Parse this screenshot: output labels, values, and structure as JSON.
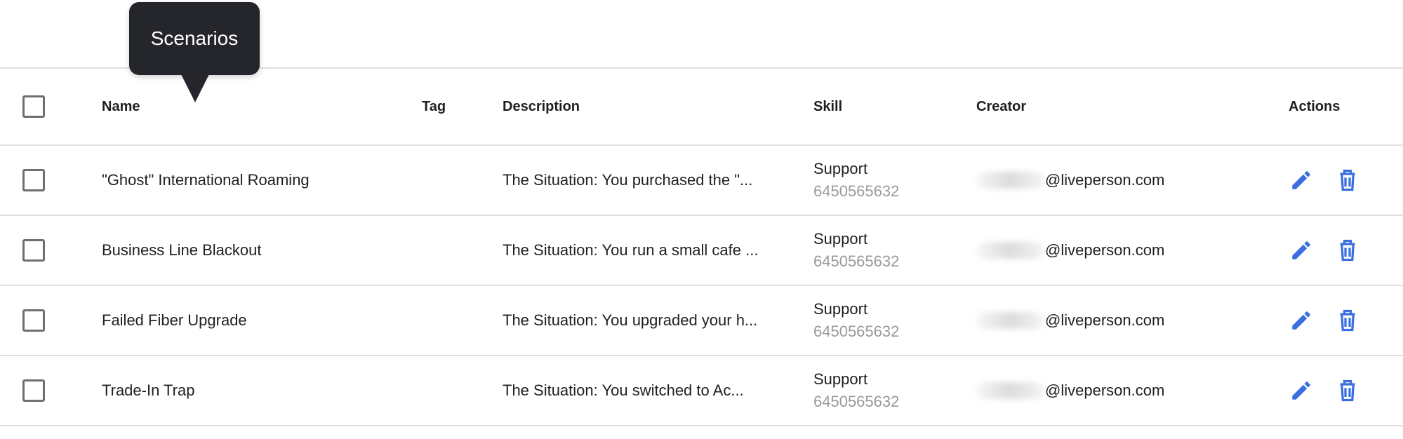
{
  "tooltip": {
    "text": "Scenarios"
  },
  "table": {
    "headers": {
      "name": "Name",
      "tag": "Tag",
      "description": "Description",
      "skill": "Skill",
      "creator": "Creator",
      "actions": "Actions"
    },
    "rows": [
      {
        "name": "\"Ghost\" International Roaming",
        "tag": "",
        "description": "The Situation: You purchased the \"...",
        "skill": "Support",
        "skill_id": "6450565632",
        "creator_domain": "@liveperson.com"
      },
      {
        "name": "Business Line Blackout",
        "tag": "",
        "description": "The Situation: You run a small cafe ...",
        "skill": "Support",
        "skill_id": "6450565632",
        "creator_domain": "@liveperson.com"
      },
      {
        "name": "Failed Fiber Upgrade",
        "tag": "",
        "description": "The Situation: You upgraded your h...",
        "skill": "Support",
        "skill_id": "6450565632",
        "creator_domain": "@liveperson.com"
      },
      {
        "name": "Trade-In Trap",
        "tag": "",
        "description": "The Situation: You switched to Ac...",
        "skill": "Support",
        "skill_id": "6450565632",
        "creator_domain": "@liveperson.com"
      }
    ]
  },
  "icons": {
    "edit": "pencil-icon",
    "delete": "trash-icon"
  },
  "colors": {
    "action_blue": "#3b6fe0",
    "tooltip_bg": "#24262c",
    "muted_text": "#9a9a9a"
  }
}
